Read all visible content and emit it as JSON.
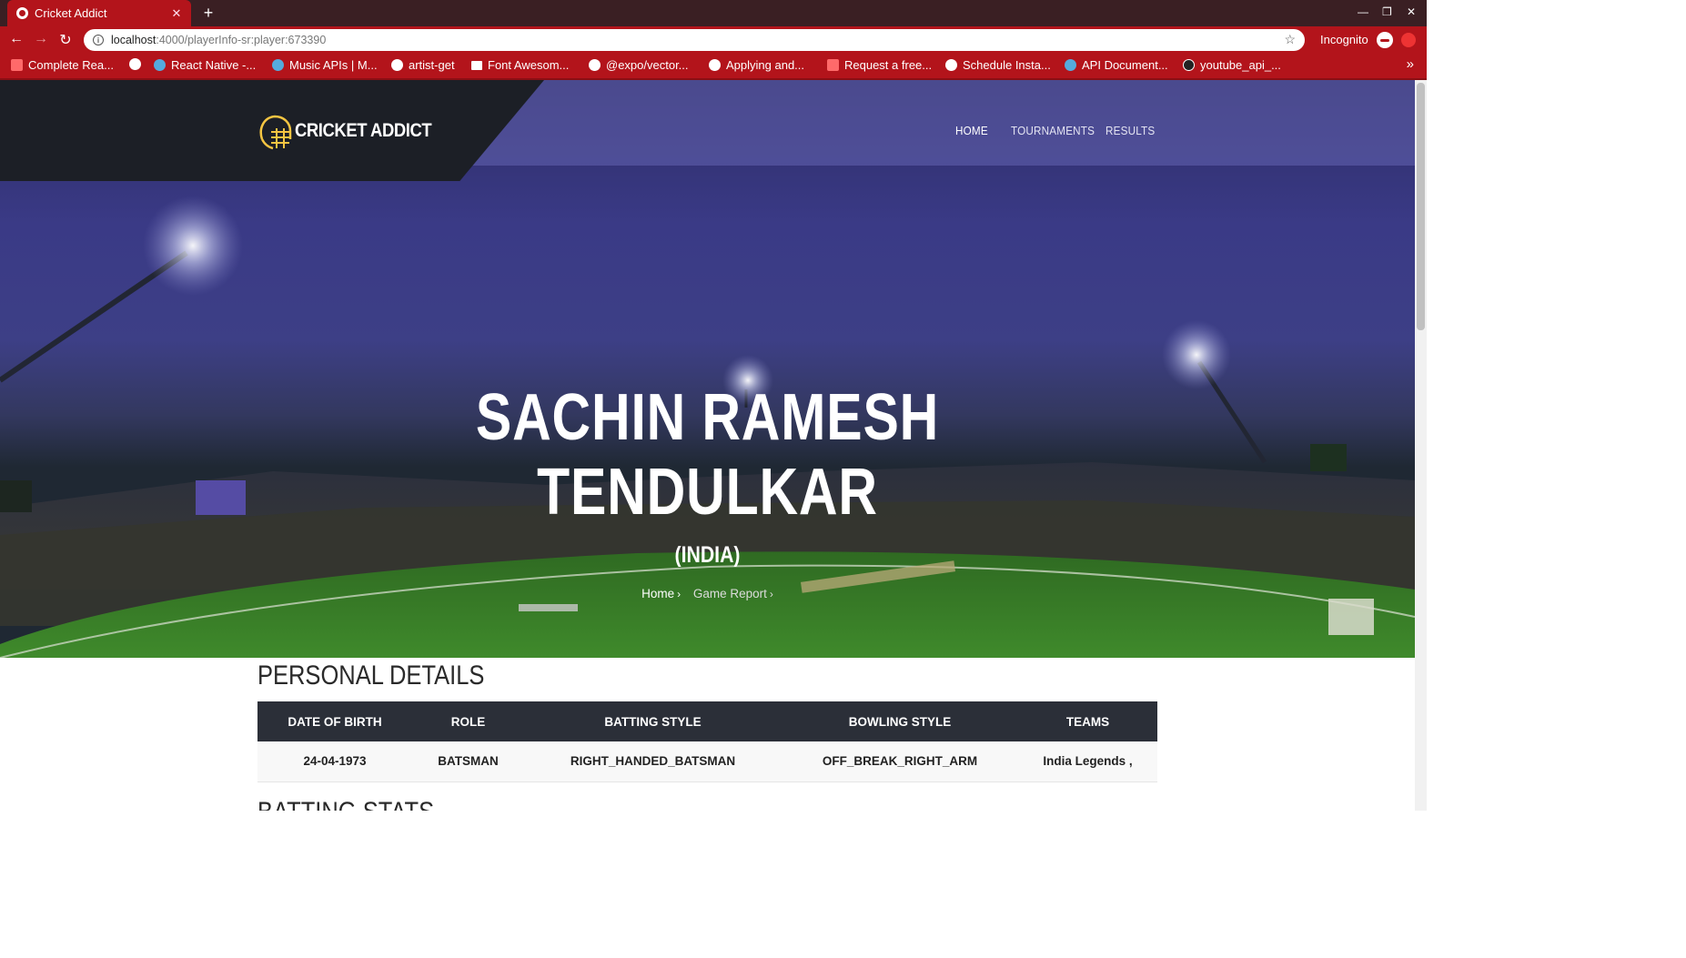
{
  "browser": {
    "tab_title": "Cricket Addict",
    "url_host": "localhost",
    "url_path": ":4000/playerInfo-sr:player:673390",
    "profile_label": "Incognito",
    "bookmarks": [
      "Complete Rea...",
      "",
      "React Native -...",
      "Music APIs | M...",
      "artist-get",
      "Font Awesom...",
      "@expo/vector...",
      "Applying and...",
      "Request a free...",
      "Schedule Insta...",
      "API Document...",
      "youtube_api_..."
    ]
  },
  "site": {
    "logo_text": "CRICKET ADDICT",
    "nav": [
      "HOME",
      "TOURNAMENTS",
      "RESULTS"
    ]
  },
  "hero": {
    "name_line1": "SACHIN RAMESH",
    "name_line2": "TENDULKAR",
    "country": "(INDIA)",
    "breadcrumb": [
      "Home",
      "Game Report"
    ]
  },
  "personal_details": {
    "title": "PERSONAL DETAILS",
    "columns": [
      "DATE OF BIRTH",
      "ROLE",
      "BATTING STYLE",
      "BOWLING STYLE",
      "TEAMS"
    ],
    "row": [
      "24-04-1973",
      "BATSMAN",
      "RIGHT_HANDED_BATSMAN",
      "OFF_BREAK_RIGHT_ARM",
      "India Legends ,"
    ]
  },
  "next_section_title": "BATTING STATS",
  "colors": {
    "chrome_red": "#b3141b",
    "header_dark": "#1c1f26",
    "table_header": "#2b2f38",
    "logo_yellow": "#f5c542"
  }
}
